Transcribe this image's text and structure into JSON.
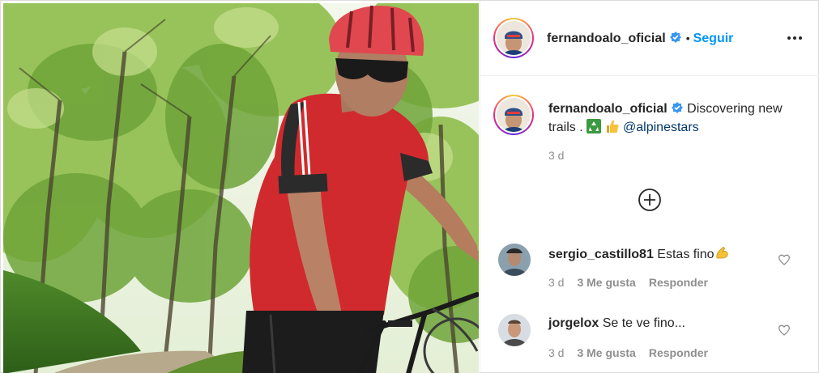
{
  "post": {
    "author": "fernandoalo_oficial",
    "verified_icon": "verified-badge-icon",
    "separator": "•",
    "follow_label": "Seguir",
    "more_icon": "more-options-icon",
    "photo_alt_icon": "cyclist-photo"
  },
  "caption": {
    "username": "fernandoalo_oficial",
    "text": "Discovering new trails .",
    "emojis": [
      "recycling-emoji",
      "thumbs-up-emoji"
    ],
    "mention": "@alpinestars",
    "time": "3 d"
  },
  "load_more_icon": "plus-circle-icon",
  "comments": [
    {
      "username": "sergio_castillo81",
      "text": "Estas fino",
      "emoji": "flexed-biceps-emoji",
      "time": "3 d",
      "likes": "3 Me gusta",
      "reply": "Responder"
    },
    {
      "username": "jorgelox",
      "text": "Se te ve fino...",
      "time": "3 d",
      "likes": "3 Me gusta",
      "reply": "Responder"
    }
  ],
  "colors": {
    "link_blue": "#0095f6",
    "mention_blue": "#00376b",
    "verified_blue": "#3897f0",
    "meta_gray": "#8e8e8e"
  }
}
